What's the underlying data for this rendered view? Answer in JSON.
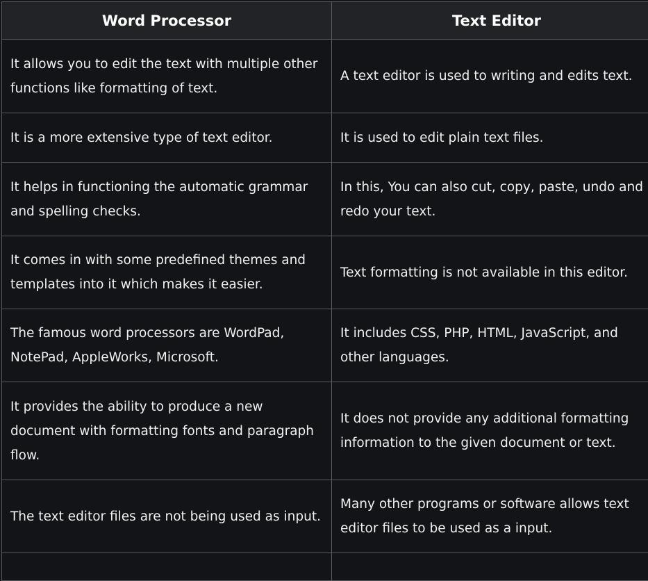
{
  "table": {
    "headers": [
      "Word Processor",
      "Text Editor"
    ],
    "rows": [
      [
        "It allows you to edit the text with multiple other functions like formatting of text.",
        "A text editor is used to writing and edits text."
      ],
      [
        "It is a more extensive type of text editor.",
        "It is used to edit plain text files."
      ],
      [
        "It helps in functioning the automatic grammar and spelling checks.",
        "In this, You can also cut, copy, paste, undo and redo your text."
      ],
      [
        "It comes in with some predefined themes and templates into it which makes it easier.",
        "Text formatting is not available in this editor."
      ],
      [
        "The famous word processors are WordPad, NotePad, AppleWorks, Microsoft.",
        "It includes CSS, PHP, HTML, JavaScript, and other languages."
      ],
      [
        "It provides the ability to produce a new document with formatting fonts and paragraph flow.",
        "It does not provide any additional formatting information to the given document or text."
      ],
      [
        "The text editor files are not being used as input.",
        "Many other programs or software allows text editor files to be used as a input."
      ],
      [
        "",
        ""
      ]
    ]
  }
}
